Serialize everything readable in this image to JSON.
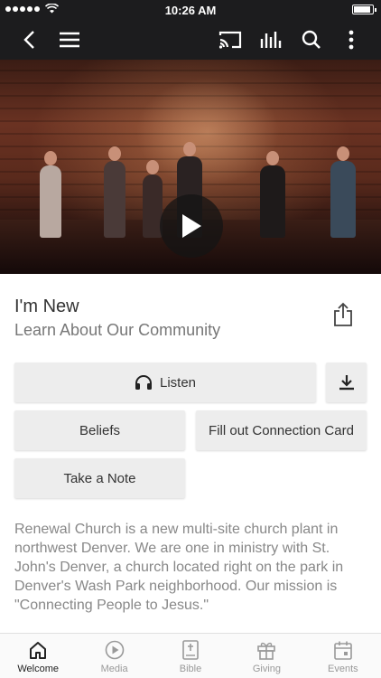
{
  "status_bar": {
    "time": "10:26 AM"
  },
  "navbar": {
    "icons": [
      "back-icon",
      "menu-icon",
      "cast-icon",
      "audio-bars-icon",
      "search-icon",
      "more-vertical-icon"
    ]
  },
  "video": {
    "play_icon": "play-icon"
  },
  "content": {
    "title": "I'm New",
    "subtitle": "Learn About Our Community",
    "buttons": {
      "listen": "Listen",
      "beliefs": "Beliefs",
      "connection_card": "Fill out Connection Card",
      "take_note": "Take a Note"
    },
    "description": "Renewal Church is a new multi-site church plant in northwest Denver. We are one in ministry with St. John's Denver, a church located right on the park in Denver's Wash Park neighborhood. Our mission is \"Connecting People to Jesus.\""
  },
  "tabbar": {
    "tabs": [
      {
        "label": "Welcome",
        "icon": "home-icon",
        "active": true
      },
      {
        "label": "Media",
        "icon": "play-circle-icon",
        "active": false
      },
      {
        "label": "Bible",
        "icon": "bible-icon",
        "active": false
      },
      {
        "label": "Giving",
        "icon": "gift-icon",
        "active": false
      },
      {
        "label": "Events",
        "icon": "calendar-icon",
        "active": false
      }
    ]
  },
  "colors": {
    "bar_dark": "#1c1c1e",
    "button_bg": "#ededed",
    "text_muted": "#888888"
  }
}
